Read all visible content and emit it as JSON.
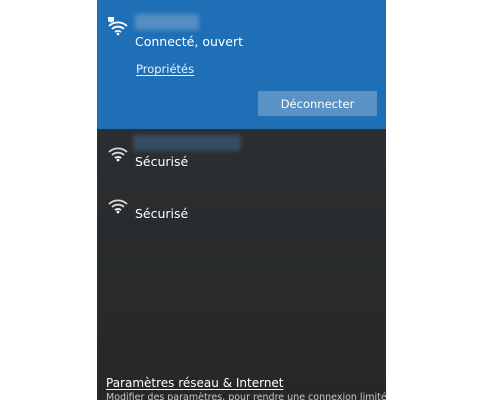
{
  "connected_network": {
    "icon": "wifi-secured-icon",
    "status": "Connecté, ouvert",
    "properties_link": "Propriétés",
    "disconnect_button": "Déconnecter",
    "accent_color": "#1f6fb6"
  },
  "networks": [
    {
      "icon": "wifi-icon",
      "status": "Sécurisé"
    },
    {
      "icon": "wifi-icon",
      "status": "Sécurisé"
    }
  ],
  "footer": {
    "settings_link": "Paramètres réseau & Internet",
    "settings_description": "Modifier des paramètres, pour rendre une connexion limitée."
  }
}
